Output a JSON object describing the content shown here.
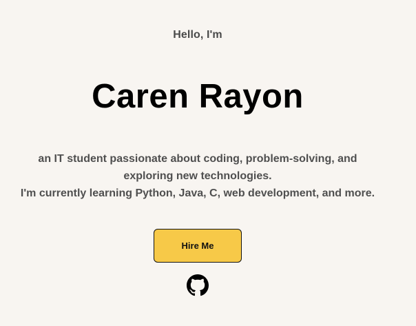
{
  "hero": {
    "greeting": "Hello, I'm",
    "name": "Caren Rayon",
    "description_lines": [
      "an IT student passionate about coding, problem-solving, and",
      "exploring new technologies.",
      "I'm currently learning Python, Java, C, web development, and more."
    ],
    "cta_label": "Hire Me",
    "social_icon": "github-icon"
  },
  "colors": {
    "background": "#f8f5f1",
    "button": "#f7c948",
    "text_primary": "#000000",
    "text_secondary": "#4f4f4f"
  }
}
